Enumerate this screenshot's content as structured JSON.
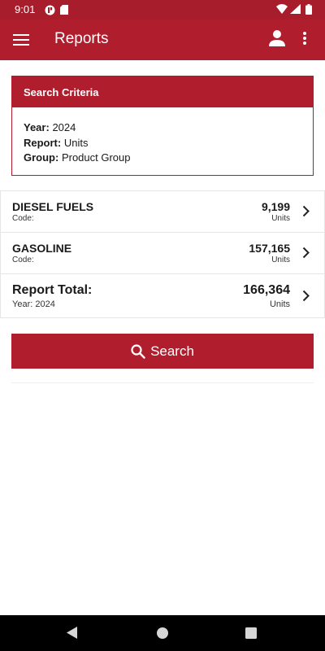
{
  "status_bar": {
    "time": "9:01",
    "icons": [
      "notification-badge-icon",
      "sd-card-icon",
      "wifi-icon",
      "signal-icon",
      "battery-icon"
    ]
  },
  "app_bar": {
    "title": "Reports",
    "icons": [
      "menu-icon",
      "account-icon",
      "more-vert-icon"
    ],
    "color": "#b01e2e"
  },
  "search_criteria": {
    "title": "Search Criteria",
    "year_label": "Year:",
    "year_value": "2024",
    "report_label": "Report:",
    "report_value": "Units",
    "group_label": "Group:",
    "group_value": "Product Group"
  },
  "results": [
    {
      "name": "DIESEL FUELS",
      "sub": "Code:",
      "value": "9,199",
      "unit": "Units"
    },
    {
      "name": "GASOLINE",
      "sub": "Code:",
      "value": "157,165",
      "unit": "Units"
    }
  ],
  "total": {
    "name": "Report Total:",
    "sub": "Year: 2024",
    "value": "166,364",
    "unit": "Units"
  },
  "search_button": {
    "label": "Search",
    "icon": "search-icon"
  },
  "nav_bar": {
    "icons": [
      "back-icon",
      "home-icon",
      "recents-icon"
    ]
  }
}
